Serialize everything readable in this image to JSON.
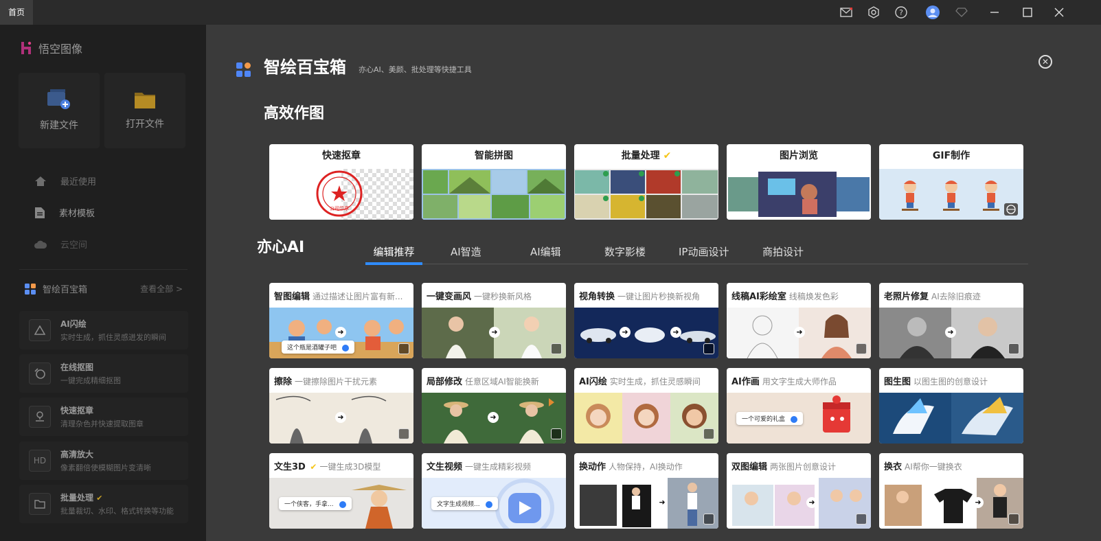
{
  "titlebar": {
    "tab_home": "首页"
  },
  "sidebar": {
    "app_name": "悟空图像",
    "new_file": "新建文件",
    "open_file": "打开文件",
    "nav": [
      "最近使用",
      "素材模板",
      "云空间"
    ],
    "section_title": "智绘百宝箱",
    "see_all": "查看全部 >",
    "cards": [
      {
        "title": "AI闪绘",
        "desc": "实时生成，抓住灵感迸发的瞬间",
        "icon": "triangle-icon"
      },
      {
        "title": "在线抠图",
        "desc": "一键完成精细抠图",
        "icon": "cutout-icon"
      },
      {
        "title": "快速抠章",
        "desc": "清理杂色并快速提取图章",
        "icon": "stamp-icon"
      },
      {
        "title": "高清放大",
        "desc": "像素翻倍使模糊图片变清晰",
        "icon": "hd-icon"
      },
      {
        "title": "批量处理",
        "desc": "批量裁切、水印、格式转换等功能",
        "icon": "folder-icon"
      }
    ]
  },
  "main": {
    "title": "智绘百宝箱",
    "subtitle": "亦心AI、美颜、批处理等快捷工具",
    "section_efficient": "高效作图",
    "quick_tools": [
      "快速抠章",
      "智能拼图",
      "批量处理",
      "图片浏览",
      "GIF制作"
    ],
    "stamp_text": "公司印章",
    "section_ai": "亦心AI",
    "tabs": [
      "编辑推荐",
      "AI智造",
      "AI编辑",
      "数字影楼",
      "IP动画设计",
      "商拍设计"
    ],
    "active_tab": "编辑推荐",
    "ai_cards": [
      {
        "title": "智图编辑",
        "desc": "通过描述让图片富有新..."
      },
      {
        "title": "一键变画风",
        "desc": "一键秒换新风格"
      },
      {
        "title": "视角转换",
        "desc": "一键让图片秒换新视角"
      },
      {
        "title": "线稿AI彩绘室",
        "desc": "线稿焕发色彩"
      },
      {
        "title": "老照片修复",
        "desc": "AI去除旧痕迹"
      },
      {
        "title": "擦除",
        "desc": "一键擦除图片干扰元素"
      },
      {
        "title": "局部修改",
        "desc": "任意区域AI智能换新"
      },
      {
        "title": "AI闪绘",
        "desc": "实时生成，抓住灵感瞬间"
      },
      {
        "title": "AI作画",
        "desc": "用文字生成大师作品"
      },
      {
        "title": "图生图",
        "desc": "以图生图的创意设计"
      },
      {
        "title": "文生3D",
        "desc": "一键生成3D模型"
      },
      {
        "title": "文生视频",
        "desc": "一键生成精彩视频"
      },
      {
        "title": "换动作",
        "desc": "人物保持，AI换动作"
      },
      {
        "title": "双图编辑",
        "desc": "两张图片创意设计"
      },
      {
        "title": "换衣",
        "desc": "AI帮你一键换衣"
      }
    ],
    "prompts": {
      "p1": "这个瓶是酒罐子吧",
      "p2": "一个可爱的礼盒",
      "p3": "一个侠客，手拿...",
      "p4": "文字生成视频..."
    }
  },
  "colors": {
    "accent": "#2f8cff",
    "vip": "#f5c518",
    "bg_main": "#3a3a3a",
    "bg_sidebar": "#1f1f1f"
  }
}
